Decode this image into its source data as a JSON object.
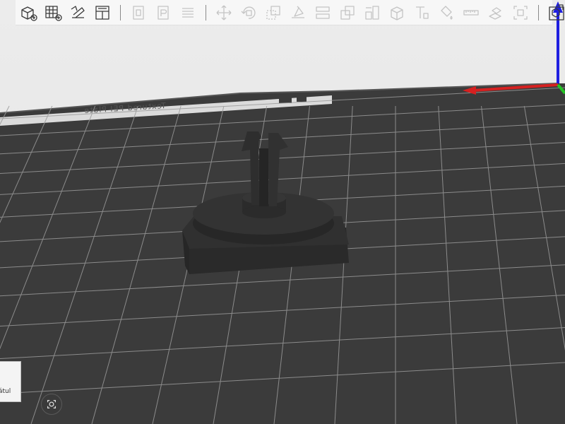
{
  "toolbar": {
    "buttons": [
      {
        "name": "add-object",
        "icon": "cube-plus-icon",
        "enabled": true
      },
      {
        "name": "add-plate",
        "icon": "grid-plus-icon",
        "enabled": true
      },
      {
        "name": "auto-orient",
        "icon": "orient-icon",
        "enabled": true
      },
      {
        "name": "arrange",
        "icon": "arrange-icon",
        "enabled": true
      },
      {
        "name": "plate-settings",
        "icon": "plate-page-icon",
        "enabled": false
      },
      {
        "name": "process-settings",
        "icon": "p-page-icon",
        "enabled": false
      },
      {
        "name": "layers-list",
        "icon": "list-icon",
        "enabled": false
      },
      {
        "name": "move",
        "icon": "move-icon",
        "enabled": false
      },
      {
        "name": "rotate",
        "icon": "rotate-icon",
        "enabled": false
      },
      {
        "name": "scale",
        "icon": "scale-icon",
        "enabled": false
      },
      {
        "name": "lay-on-face",
        "icon": "lay-on-face-icon",
        "enabled": false
      },
      {
        "name": "cut",
        "icon": "cut-icon",
        "enabled": false
      },
      {
        "name": "boolean",
        "icon": "boolean-icon",
        "enabled": false
      },
      {
        "name": "support-paint",
        "icon": "support-paint-icon",
        "enabled": false
      },
      {
        "name": "seam-paint",
        "icon": "seam-paint-icon",
        "enabled": false
      },
      {
        "name": "text",
        "icon": "text-icon",
        "enabled": false
      },
      {
        "name": "color-paint",
        "icon": "color-paint-icon",
        "enabled": false
      },
      {
        "name": "measure",
        "icon": "ruler-icon",
        "enabled": false
      },
      {
        "name": "assembly",
        "icon": "assembly-icon",
        "enabled": false
      },
      {
        "name": "fit-view",
        "icon": "fit-view-icon",
        "enabled": false
      },
      {
        "name": "split-view",
        "icon": "split-view-icon",
        "enabled": true
      }
    ]
  },
  "bed": {
    "label": "Textured PEI Plate"
  },
  "view_cube": {
    "label": "átul"
  },
  "colors": {
    "bed": "#3b3b3b",
    "grid": "#9a9a9a",
    "model": "#2f2f2f",
    "x_axis": "#d62020",
    "y_axis": "#23c423",
    "z_axis": "#1f1fe0",
    "background": "#e6e6e6"
  }
}
